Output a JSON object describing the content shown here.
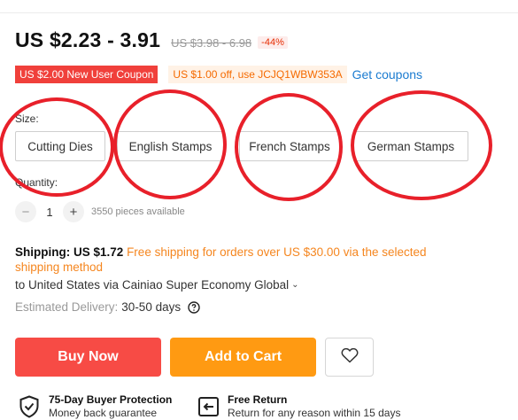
{
  "price": {
    "current": "US $2.23 - 3.91",
    "original": "US $3.98 - 6.98",
    "discount": "-44%"
  },
  "coupons": {
    "new_user": "US $2.00 New User Coupon",
    "code_offer": "US $1.00 off, use JCJQ1WBW353A",
    "get_link": "Get coupons"
  },
  "size": {
    "label": "Size:",
    "options": [
      "Cutting Dies",
      "English Stamps",
      "French Stamps",
      "German Stamps"
    ]
  },
  "quantity": {
    "label": "Quantity:",
    "minus": "−",
    "value": "1",
    "plus": "+",
    "available": "3550 pieces available"
  },
  "shipping": {
    "label": "Shipping:",
    "price": "US $1.72",
    "free_note": "Free shipping for orders over US $30.00 via the selected shipping method",
    "destination": "to United States via Cainiao Super Economy Global",
    "delivery_label": "Estimated Delivery:",
    "delivery_days": "30-50 days"
  },
  "actions": {
    "buy_now": "Buy Now",
    "add_to_cart": "Add to Cart"
  },
  "features": [
    {
      "title": "75-Day Buyer Protection",
      "subtitle": "Money back guarantee",
      "icon": "shield-check-icon"
    },
    {
      "title": "Free Return",
      "subtitle": "Return for any reason within 15 days",
      "icon": "return-icon"
    }
  ],
  "colors": {
    "buy_now": "#f74b45",
    "add_to_cart": "#ff9a12",
    "annotation_circles": "#e8202a",
    "coupon_red": "#f0403b",
    "link": "#1a7bd0"
  }
}
